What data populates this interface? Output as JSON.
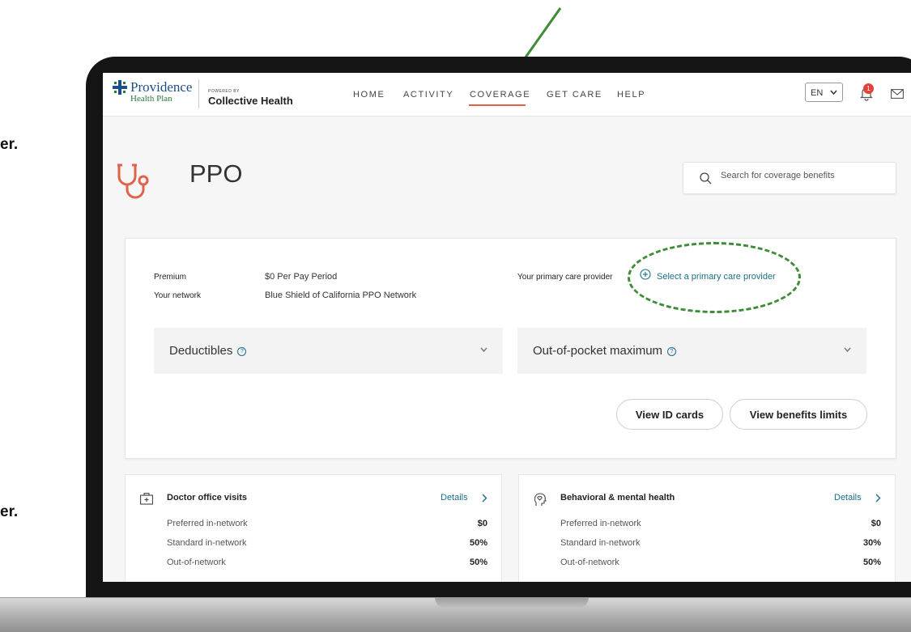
{
  "side_fragments": [
    "er.",
    "er."
  ],
  "logo": {
    "name": "Providence",
    "sub": "Health Plan",
    "powered": "POWERED BY",
    "partner": "Collective Health"
  },
  "nav": [
    "HOME",
    "ACTIVITY",
    "COVERAGE",
    "GET CARE",
    "HELP"
  ],
  "nav_active": "COVERAGE",
  "header": {
    "language": "EN",
    "notification_count": "1"
  },
  "page": {
    "title": "PPO",
    "search_placeholder": "Search for coverage benefits"
  },
  "summary": {
    "premium_label": "Premium",
    "premium_value": "$0 Per Pay Period",
    "network_label": "Your network",
    "network_value": "Blue Shield of California PPO Network",
    "pcp_label": "Your primary care provider",
    "pcp_link": "Select a primary care provider",
    "deductibles": "Deductibles",
    "oop": "Out-of-pocket maximum",
    "btn_id": "View ID cards",
    "btn_limits": "View benefits limits"
  },
  "benefits": [
    {
      "title": "Doctor office visits",
      "details": "Details",
      "rows": [
        {
          "label": "Preferred in-network",
          "value": "$0"
        },
        {
          "label": "Standard in-network",
          "value": "50%"
        },
        {
          "label": "Out-of-network",
          "value": "50%"
        }
      ]
    },
    {
      "title": "Behavioral & mental health",
      "details": "Details",
      "rows": [
        {
          "label": "Preferred in-network",
          "value": "$0"
        },
        {
          "label": "Standard in-network",
          "value": "30%"
        },
        {
          "label": "Out-of-network",
          "value": "50%"
        }
      ]
    }
  ],
  "colors": {
    "accent": "#e0624a",
    "link": "#1a6f86",
    "annotation": "#3c8c38"
  }
}
